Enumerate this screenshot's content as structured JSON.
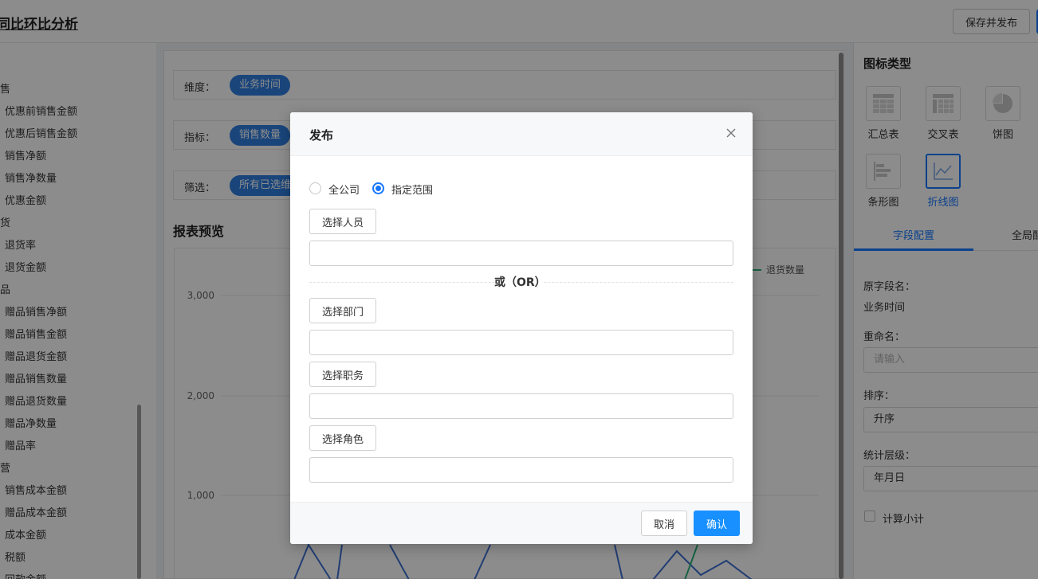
{
  "header": {
    "title": "同比环比分析",
    "save_publish_label": "保存并发布"
  },
  "field_list": {
    "items": [
      {
        "label": "销售",
        "group": true
      },
      {
        "label": "优惠前销售金额",
        "group": false
      },
      {
        "label": "优惠后销售金额",
        "group": false
      },
      {
        "label": "销售净额",
        "group": false
      },
      {
        "label": "销售净数量",
        "group": false
      },
      {
        "label": "优惠金额",
        "group": false
      },
      {
        "label": "退货",
        "group": true
      },
      {
        "label": "退货率",
        "group": false
      },
      {
        "label": "退货金额",
        "group": false
      },
      {
        "label": "赠品",
        "group": true
      },
      {
        "label": "赠品销售净额",
        "group": false
      },
      {
        "label": "赠品销售金额",
        "group": false
      },
      {
        "label": "赠品退货金额",
        "group": false
      },
      {
        "label": "赠品销售数量",
        "group": false
      },
      {
        "label": "赠品退货数量",
        "group": false
      },
      {
        "label": "赠品净数量",
        "group": false
      },
      {
        "label": "赠品率",
        "group": false
      },
      {
        "label": "经营",
        "group": true
      },
      {
        "label": "销售成本金额",
        "group": false
      },
      {
        "label": "赠品成本金额",
        "group": false
      },
      {
        "label": "成本金额",
        "group": false
      },
      {
        "label": "税额",
        "group": false
      },
      {
        "label": "回款金额",
        "group": false
      }
    ]
  },
  "config": {
    "dimension_label": "维度：",
    "dimension_value": "业务时间",
    "metric_label": "指标：",
    "metric_value": "销售数量",
    "filter_label": "筛选：",
    "filter_value": "所有已选维度"
  },
  "preview": {
    "title": "报表预览"
  },
  "chart_data": {
    "type": "line",
    "y_ticks": [
      "3,000",
      "2,000",
      "1,000"
    ],
    "ylim": [
      0,
      3000
    ],
    "legend": [
      {
        "name": "退货数量",
        "color": "#2db37a"
      }
    ],
    "series": [
      {
        "name": "",
        "color": "#3d6fd1"
      },
      {
        "name": "退货数量",
        "color": "#2db37a"
      }
    ]
  },
  "right_panel": {
    "chart_type_title": "图标类型",
    "chart_types": [
      {
        "label": "汇总表",
        "icon": "summary-table-icon",
        "active": false
      },
      {
        "label": "交叉表",
        "icon": "cross-table-icon",
        "active": false
      },
      {
        "label": "饼图",
        "icon": "pie-chart-icon",
        "active": false
      },
      {
        "label": "条形图",
        "icon": "bar-chart-icon",
        "active": false
      },
      {
        "label": "折线图",
        "icon": "line-chart-icon",
        "active": true
      }
    ],
    "tabs": [
      {
        "label": "字段配置",
        "active": true
      },
      {
        "label": "全局配置",
        "active": false
      }
    ],
    "original_field_label": "原字段名：",
    "original_field_value": "业务时间",
    "rename_label": "重命名：",
    "rename_placeholder": "请输入",
    "sort_label": "排序：",
    "sort_value": "升序",
    "level_label": "统计层级：",
    "level_value": "年月日",
    "subtotal_label": "计算小计",
    "accent_color": "#1677ff"
  },
  "modal": {
    "title": "发布",
    "scope_options": [
      {
        "label": "全公司",
        "checked": false
      },
      {
        "label": "指定范围",
        "checked": true
      }
    ],
    "select_people": "选择人员",
    "or_text": "或（OR）",
    "select_department": "选择部门",
    "select_position": "选择职务",
    "select_role": "选择角色",
    "cancel": "取消",
    "confirm": "确认"
  }
}
